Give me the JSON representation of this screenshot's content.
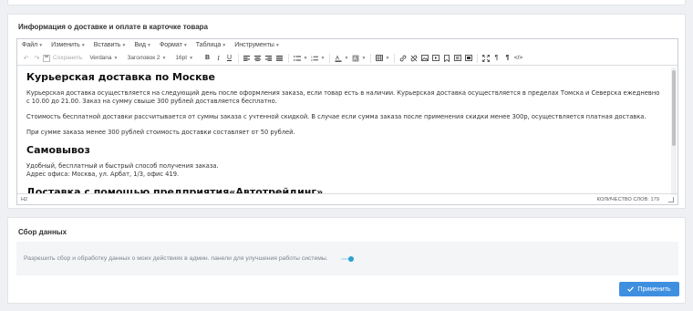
{
  "editor_section": {
    "title": "Информация о доставке и оплате в карточке товара",
    "menubar": [
      {
        "label": "Файл"
      },
      {
        "label": "Изменить"
      },
      {
        "label": "Вставить"
      },
      {
        "label": "Вид"
      },
      {
        "label": "Формат"
      },
      {
        "label": "Таблица"
      },
      {
        "label": "Инструменты"
      }
    ],
    "toolbar": {
      "save_label": "Сохранить",
      "font_family": "Verdana",
      "block_format": "Заголовок 2",
      "font_size": "16pt"
    },
    "content": {
      "h_moscow": "Курьерская доставка по Москве",
      "p_courier_1": "Курьерская доставка осуществляется на следующий день после оформления заказа, если товар есть в наличии. Курьерская доставка осуществляется в пределах Томска и Северска ежедневно с 10.00 до 21.00. Заказ на сумму свыше 300 рублей доставляется бесплатно.",
      "p_courier_2": "Стоимость бесплатной доставки рассчитывается от суммы заказа с учтенной скидкой. В случае если сумма заказа после применения скидки менее 300р, осуществляется платная доставка.",
      "p_courier_3": "При сумме заказа менее 300 рублей стоимость доставки составляет от 50 рублей.",
      "h_pickup": "Самовывоз",
      "p_pickup_1": "Удобный, бесплатный и быстрый способ получения заказа.",
      "p_pickup_2": "Адрес офиса: Москва, ул. Арбат, 1/3, офис 419.",
      "h_transport": "Доставка с помощью предприятия«Автотрейдинг»"
    },
    "statusbar": {
      "path": "H2",
      "word_count": "КОЛИЧЕСТВО СЛОВ: 179"
    }
  },
  "data_section": {
    "title": "Сбор данных",
    "consent_text": "Разрешить сбор и обработку данных о моих действиях в админ. панели для улучшения работы системы.",
    "consent_enabled": true,
    "apply_label": "Применить"
  },
  "colors": {
    "accent": "#3f8fe0",
    "toggle": "#2e9fd3",
    "background": "#eef0f3"
  }
}
